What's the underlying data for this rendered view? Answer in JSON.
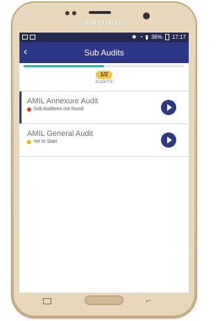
{
  "device": {
    "brand": "SAMSUNG"
  },
  "statusbar": {
    "battery_text": "36%",
    "time": "17:17"
  },
  "appbar": {
    "back_icon": "chevron-left-icon",
    "title": "Sub Audits"
  },
  "progress": {
    "fraction": 0.5,
    "fill_color": "#2ab59f"
  },
  "audits": {
    "badge": "1/2",
    "caption": "AUDITS"
  },
  "items": [
    {
      "title": "AMIL Annexure Audit",
      "status": "Sub Auditees not found",
      "status_color": "#e53935",
      "action_icon": "play-icon"
    },
    {
      "title": "AMIL General Audit",
      "status": "Yet to Start",
      "status_color": "#f2b705",
      "action_icon": "play-icon"
    }
  ],
  "colors": {
    "primary": "#2d3787",
    "statusbar": "#242a4f"
  }
}
